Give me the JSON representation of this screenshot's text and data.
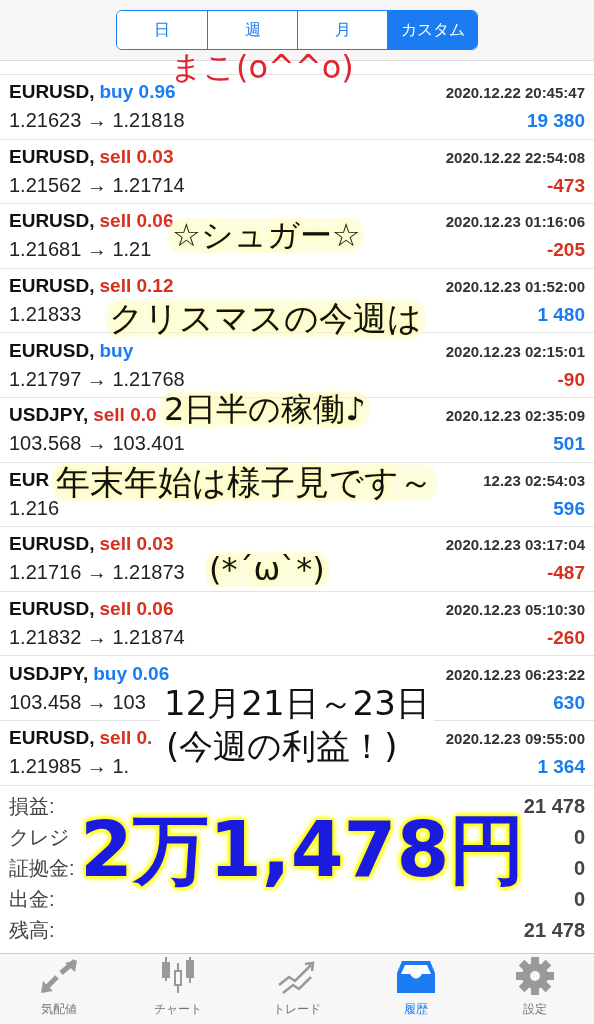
{
  "period_tabs": [
    {
      "label": "日",
      "selected": false
    },
    {
      "label": "週",
      "selected": false
    },
    {
      "label": "月",
      "selected": false
    },
    {
      "label": "カスタム",
      "selected": true
    }
  ],
  "deals": [
    {
      "symbol": "EURUSD,",
      "buy": true,
      "trade": "buy 0.96",
      "time": "2020.12.22 20:45:47",
      "prices": "1.21623 → 1.21818",
      "profit": "19 380",
      "loss": false
    },
    {
      "symbol": "EURUSD,",
      "buy": false,
      "trade": "sell 0.03",
      "time": "2020.12.22 22:54:08",
      "prices": "1.21562 → 1.21714",
      "profit": "-473",
      "loss": true
    },
    {
      "symbol": "EURUSD,",
      "buy": false,
      "trade": "sell 0.06",
      "time": "2020.12.23 01:16:06",
      "prices": "1.21681 → 1.21",
      "profit": "-205",
      "loss": true
    },
    {
      "symbol": "EURUSD,",
      "buy": false,
      "trade": "sell 0.12",
      "time": "2020.12.23 01:52:00",
      "prices": "1.21833",
      "profit": "1 480",
      "loss": false
    },
    {
      "symbol": "EURUSD,",
      "buy": true,
      "trade": "buy",
      "time": "2020.12.23 02:15:01",
      "prices": "1.21797 → 1.21768",
      "profit": "-90",
      "loss": true
    },
    {
      "symbol": "USDJPY,",
      "buy": false,
      "trade": "sell 0.0",
      "time": "2020.12.23 02:35:09",
      "prices": "103.568 → 103.401",
      "profit": "501",
      "loss": false
    },
    {
      "symbol": "EUR",
      "time": "12.23 02:54:03",
      "prices": "1.216",
      "profit": "596",
      "loss": false
    },
    {
      "symbol": "EURUSD,",
      "buy": false,
      "trade": "sell 0.03",
      "time": "2020.12.23 03:17:04",
      "prices": "1.21716 → 1.21873",
      "profit": "-487",
      "loss": true
    },
    {
      "symbol": "EURUSD,",
      "buy": false,
      "trade": "sell 0.06",
      "time": "2020.12.23 05:10:30",
      "prices": "1.21832 → 1.21874",
      "profit": "-260",
      "loss": true
    },
    {
      "symbol": "USDJPY,",
      "buy": true,
      "trade": "buy 0.06",
      "time": "2020.12.23 06:23:22",
      "prices": "103.458 → 103",
      "profit": "630",
      "loss": false
    },
    {
      "symbol": "EURUSD,",
      "buy": false,
      "trade": "sell 0.",
      "time": "2020.12.23 09:55:00",
      "prices": "1.21985 → 1.",
      "profit": "1 364",
      "loss": false
    }
  ],
  "summary": [
    {
      "label": "損益:",
      "value": "21 478"
    },
    {
      "label": "クレジ",
      "value": "0"
    },
    {
      "label": "証拠金:",
      "value": "0"
    },
    {
      "label": "出金:",
      "value": "0"
    },
    {
      "label": "残高:",
      "value": "21 478"
    }
  ],
  "annotations": [
    {
      "text": "まこ(o^^o)",
      "kind": "signature"
    },
    {
      "text": "☆シュガー☆",
      "kind": "highlighted"
    },
    {
      "text": "クリスマスの今週は",
      "kind": "highlighted"
    },
    {
      "text": "2日半の稼働♪",
      "kind": "highlighted"
    },
    {
      "text": "年末年始は様子見です～",
      "kind": "highlighted"
    },
    {
      "text": "(*´ω`*)",
      "kind": "highlighted"
    },
    {
      "text": "12月21日～23日",
      "kind": "ink"
    },
    {
      "text": "(今週の利益！)",
      "kind": "ink"
    },
    {
      "text": "2万1,478円",
      "kind": "marker"
    }
  ],
  "bottom_tabs": [
    {
      "label": "気配値",
      "selected": false
    },
    {
      "label": "チャート",
      "selected": false
    },
    {
      "label": "トレード",
      "selected": false
    },
    {
      "label": "履歴",
      "selected": true
    },
    {
      "label": "設定",
      "selected": false
    }
  ]
}
